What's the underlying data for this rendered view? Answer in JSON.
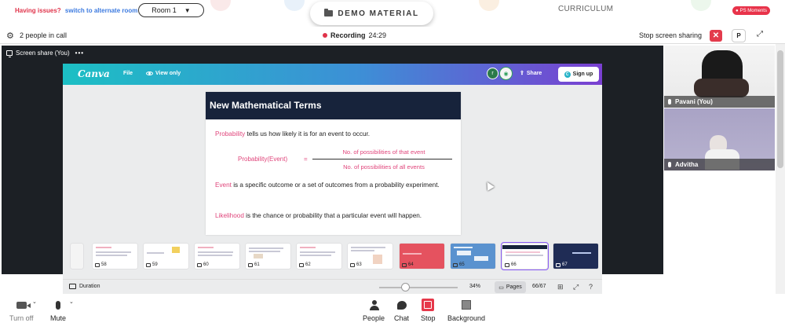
{
  "topbar": {
    "issues_text": "Having issues?",
    "alternate_link": "switch to alternate room",
    "room": "Room 1",
    "demo_material": "DEMO MATERIAL",
    "curriculum": "CURRICULUM",
    "moments": "PS Moments"
  },
  "callbar": {
    "people_count": "2 people in call",
    "recording_label": "Recording",
    "recording_time": "24:29",
    "stop_sharing": "Stop screen sharing",
    "close_glyph": "✕",
    "profile_initial": "P"
  },
  "share": {
    "label": "Screen share (You)",
    "more": "•••"
  },
  "canva": {
    "logo": "Canva",
    "file": "File",
    "view_only": "View only",
    "avatar1": "r",
    "share": "Share",
    "signup": "Sign up"
  },
  "slide": {
    "title": "New Mathematical Terms",
    "p1_kw": "Probability",
    "p1_rest": " tells us how likely it is for an event to occur.",
    "formula_left": "Probability(Event)",
    "formula_eq": "=",
    "formula_num": "No. of possibilities of that event",
    "formula_den": "No. of possibilities of all events",
    "p2_kw": "Event",
    "p2_rest": " is a specific outcome or a set of outcomes from a probability experiment.",
    "p3_kw": "Likelihood",
    "p3_rest": " is the chance or probability that a particular event will happen."
  },
  "thumbnails": [
    "58",
    "59",
    "60",
    "61",
    "62",
    "63",
    "64",
    "65",
    "66",
    "67"
  ],
  "footer": {
    "duration": "Duration",
    "zoom_percent": "34%",
    "zoom_level": 0.34,
    "pages": "Pages",
    "page_count": "66/67"
  },
  "participants": [
    {
      "name": "Pavani (You)"
    },
    {
      "name": "Advitha"
    }
  ],
  "controls": {
    "camera": "Turn off",
    "mute": "Mute",
    "people": "People",
    "chat": "Chat",
    "stop": "Stop",
    "background": "Background"
  }
}
